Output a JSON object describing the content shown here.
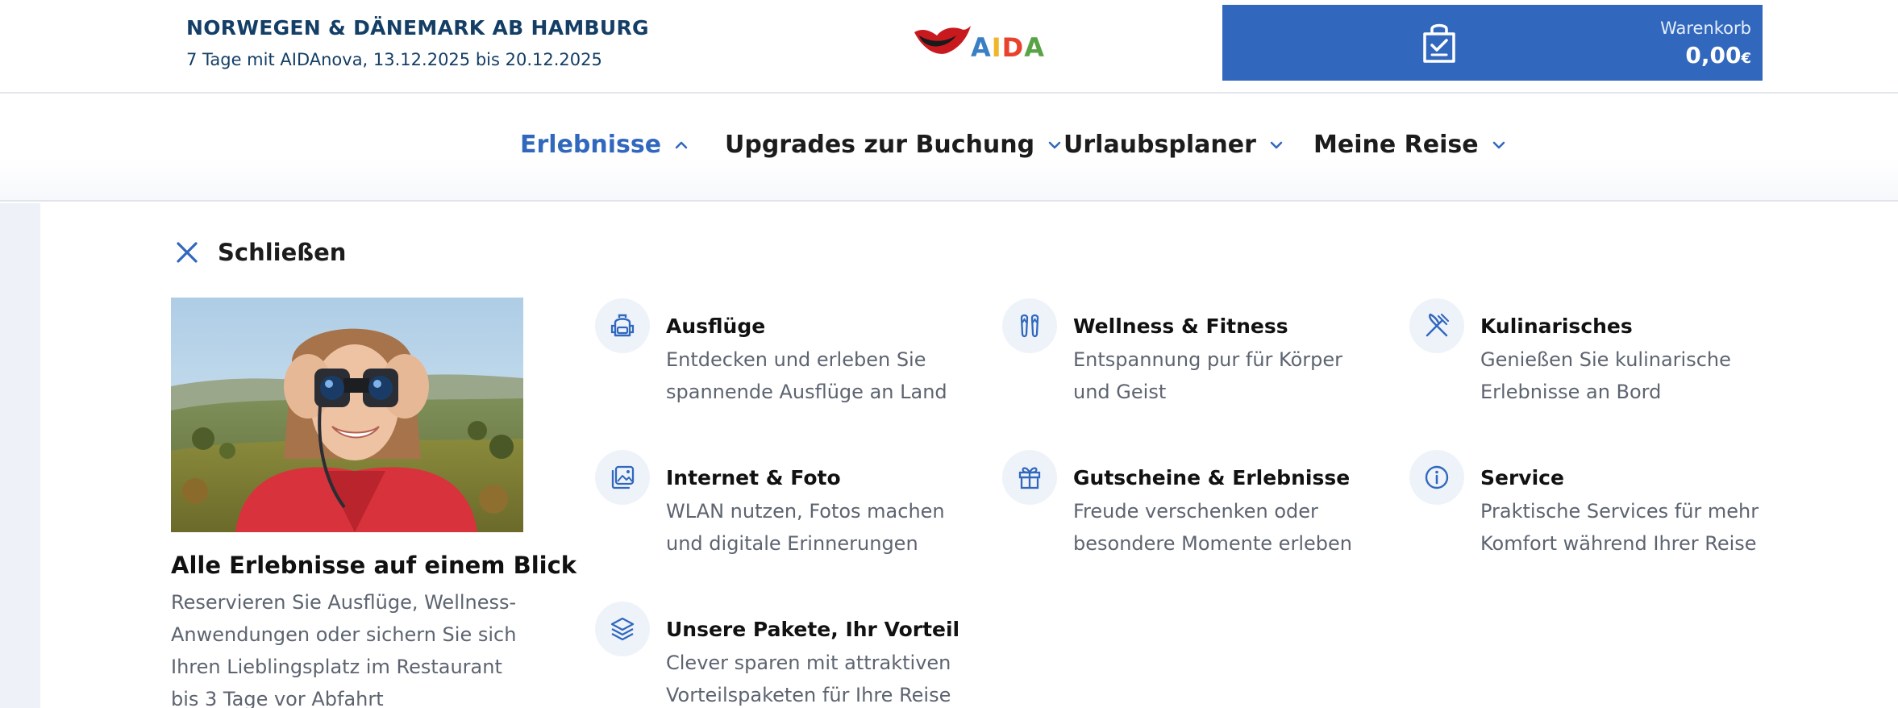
{
  "header": {
    "trip_title": "NORWEGEN & DÄNEMARK AB HAMBURG",
    "trip_subtitle": "7 Tage mit AIDAnova, 13.12.2025 bis 20.12.2025",
    "logo_text": "AIDA",
    "cart": {
      "label": "Warenkorb",
      "amount": "0,00",
      "currency": "€",
      "icon": "shopping-bag-icon"
    }
  },
  "nav": {
    "items": [
      {
        "label": "Erlebnisse",
        "active": true
      },
      {
        "label": "Upgrades zur Buchung",
        "active": false
      },
      {
        "label": "Urlaubsplaner",
        "active": false
      },
      {
        "label": "Meine Reise",
        "active": false
      }
    ]
  },
  "panel": {
    "close_label": "Schließen",
    "hero": {
      "title": "Alle Erlebnisse auf einem Blick",
      "description": "Reservieren Sie Ausflüge, Wellness-Anwendungen oder sichern Sie sich Ihren Lieblingsplatz im Restaurant bis 3 Tage vor Abfahrt"
    },
    "categories": [
      {
        "icon": "backpack-icon",
        "title": "Ausflüge",
        "description": "Entdecken und erleben Sie spannende Ausflüge an Land"
      },
      {
        "icon": "flip-flops-icon",
        "title": "Wellness & Fitness",
        "description": "Entspannung pur für Körper und Geist"
      },
      {
        "icon": "fork-knife-icon",
        "title": "Kulinarisches",
        "description": "Genießen Sie kulinarische Erlebnisse an Bord"
      },
      {
        "icon": "photo-gallery-icon",
        "title": "Internet & Foto",
        "description": "WLAN nutzen, Fotos machen und digitale Erinnerungen"
      },
      {
        "icon": "gift-icon",
        "title": "Gutscheine & Erlebnisse",
        "description": "Freude verschenken oder besondere Momente erleben"
      },
      {
        "icon": "info-icon",
        "title": "Service",
        "description": "Praktische Services für mehr Komfort während Ihrer Reise"
      },
      {
        "icon": "layers-icon",
        "title": "Unsere Pakete, Ihr Vorteil",
        "description": "Clever sparen mit attraktiven Vorteilspaketen für Ihre Reise"
      }
    ]
  },
  "colors": {
    "brand_blue": "#3168bd",
    "navy": "#143e66",
    "muted_text": "#5d6470",
    "icon_bg": "#eef3fa"
  }
}
